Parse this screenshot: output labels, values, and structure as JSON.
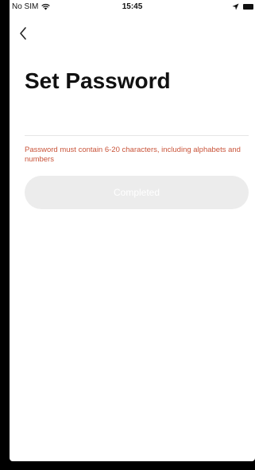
{
  "status_bar": {
    "carrier": "No SIM",
    "time": "15:45",
    "wifi_icon": "wifi-icon",
    "location_icon": "location-arrow-icon",
    "battery_icon": "battery-icon"
  },
  "nav": {
    "back_icon": "chevron-left-icon"
  },
  "page": {
    "title": "Set Password",
    "password_field": {
      "value": "",
      "placeholder": ""
    },
    "hint": "Password must contain 6-20 characters, including alphabets and numbers",
    "hint_color": "#c9543a",
    "submit_label": "Completed",
    "submit_bg": "#ececec"
  }
}
